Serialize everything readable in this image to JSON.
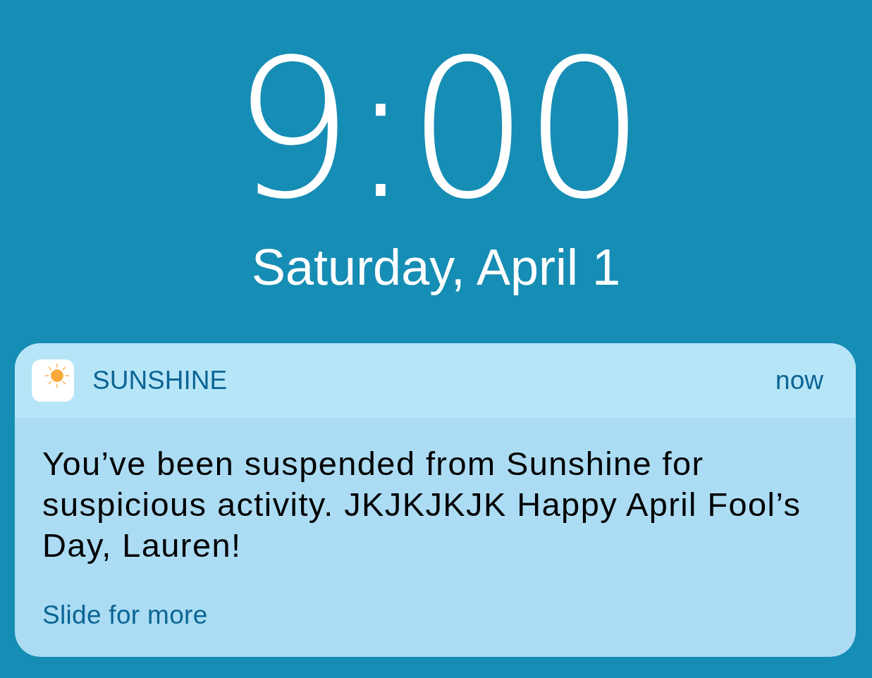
{
  "lock_screen": {
    "time": "9:00",
    "date": "Saturday, April 1"
  },
  "notification": {
    "app_name": "SUNSHINE",
    "timestamp": "now",
    "message": "You’ve been suspended from Sunshine for suspicious activity. JKJKJKJK Happy April Fool’s Day, Lauren!",
    "hint": "Slide for more"
  }
}
